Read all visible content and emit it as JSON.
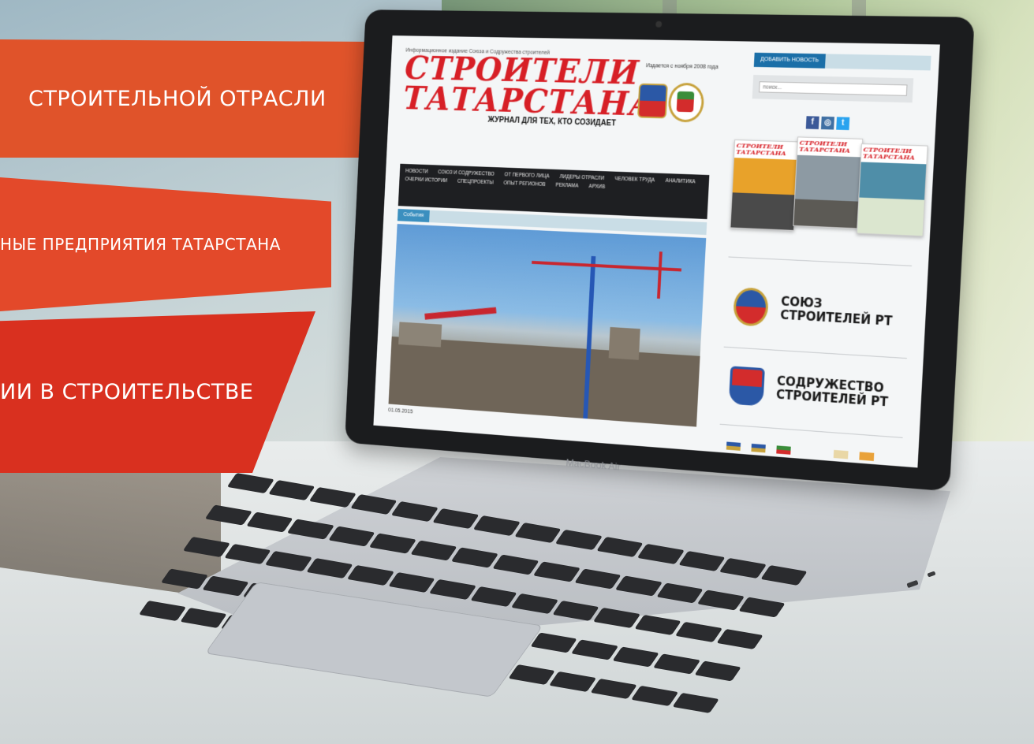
{
  "banners": [
    "СТРОИТЕЛЬНОЙ ОТРАСЛИ",
    "НЫЕ ПРЕДПРИЯТИЯ ТАТАРСТАНА",
    "ИИ В СТРОИТЕЛЬСТВЕ"
  ],
  "laptop": {
    "brand": "MacBook Air"
  },
  "site": {
    "tagline_top": "Информационное издание Союза и Содружества строителей",
    "founded": "Издается с ноября 2008 года",
    "logo_line1": "СТРОИТЕЛИ",
    "logo_line2": "ТАТАРСТАНА",
    "logo_subtitle": "ЖУРНАЛ ДЛЯ ТЕХ, КТО СОЗИДАЕТ",
    "nav": [
      "Новости",
      "Союз и Содружество",
      "От первого лица",
      "Лидеры отрасли",
      "Человек труда",
      "Аналитика",
      "Очерки истории",
      "Спецпроекты",
      "Опыт регионов",
      "Реклама",
      "Архив"
    ],
    "section_tab": "События",
    "hero_date": "01.05.2015",
    "sidebar": {
      "add_news": "Добавить новость",
      "search_placeholder": "поиск...",
      "social": {
        "facebook": "f",
        "instagram": "◎",
        "twitter": "t"
      },
      "magazine_title": "СТРОИТЕЛИ ТАТАРСТАНА",
      "partners": [
        "СОЮЗ\nСТРОИТЕЛЕЙ РТ",
        "СОДРУЖЕСТВО\nСТРОИТЕЛЕЙ РТ"
      ]
    }
  },
  "colors": {
    "banner_orange": "#e0532a",
    "banner_red": "#d9301f",
    "logo_red": "#d71f26",
    "nav_bg": "#1e1f22",
    "accent_blue": "#1b6fa8"
  }
}
